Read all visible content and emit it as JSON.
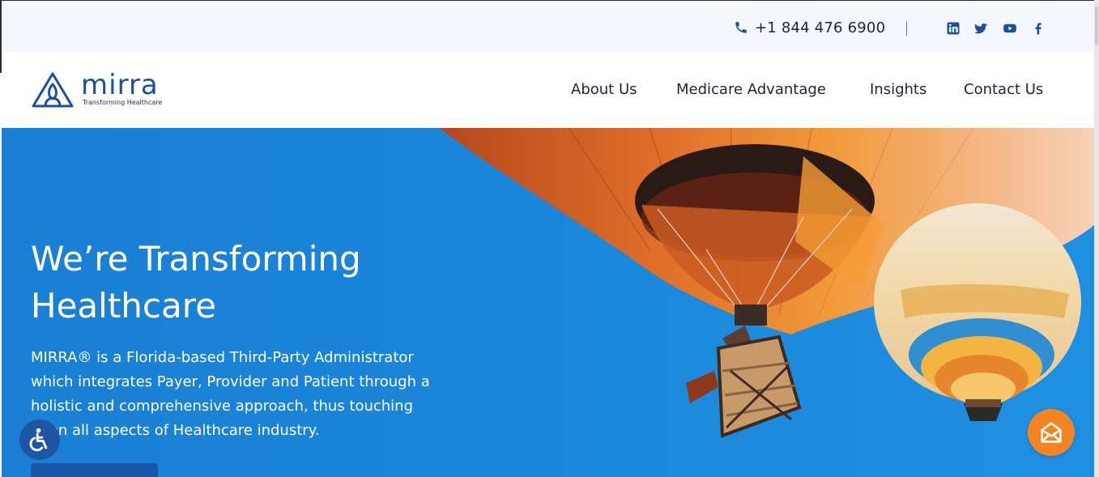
{
  "topbar": {
    "phone_icon": "phone-icon",
    "phone": "+1 844 476 6900",
    "divider": "|",
    "social": [
      {
        "name": "linkedin-icon"
      },
      {
        "name": "twitter-icon"
      },
      {
        "name": "youtube-icon"
      },
      {
        "name": "facebook-icon"
      }
    ]
  },
  "logo": {
    "word": "mirra",
    "tagline": "Transforming Healthcare",
    "icon": "mirra-triangle-logo-icon",
    "color": "#1c4fa0"
  },
  "nav": {
    "items": [
      "About Us",
      "Medicare Advantage",
      "Insights",
      "Contact Us"
    ]
  },
  "hero": {
    "title": "We’re Transforming Healthcare",
    "description": "MIRRA® is a Florida-based Third-Party Administrator which integrates Payer, Provider and Patient through a holistic and comprehensive approach, thus touching upon all aspects of Healthcare industry.",
    "button_label": "",
    "background_color": "#1c85d8",
    "image": "hot-air-balloons-illustration"
  },
  "floating": {
    "accessibility_icon": "accessibility-icon",
    "contact_icon": "mail-contact-icon",
    "accent": "#f48522"
  },
  "colors": {
    "brand_blue": "#1c4fa0",
    "hero_blue": "#1c85d8",
    "topbar_bg": "#f4f7fb",
    "text_dark": "#1d2433"
  }
}
